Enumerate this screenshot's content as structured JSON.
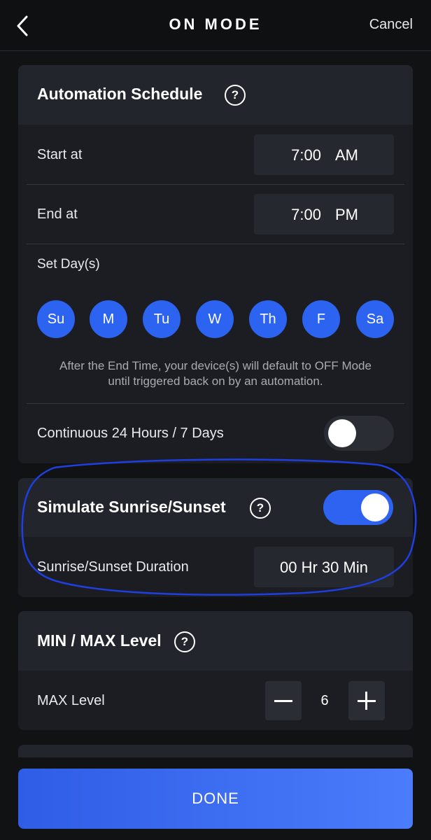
{
  "header": {
    "title": "ON MODE",
    "cancel_label": "Cancel"
  },
  "schedule": {
    "title": "Automation Schedule",
    "start_label": "Start at",
    "start_time": "7:00",
    "start_ampm": "AM",
    "end_label": "End at",
    "end_time": "7:00",
    "end_ampm": "PM",
    "days_label": "Set Day(s)",
    "days": [
      "Su",
      "M",
      "Tu",
      "W",
      "Th",
      "F",
      "Sa"
    ],
    "note_line1": "After the End Time, your device(s) will default to OFF Mode",
    "note_line2": "until triggered back on by an automation.",
    "continuous_label": "Continuous 24 Hours / 7 Days",
    "continuous_on": false
  },
  "sunrise": {
    "title": "Simulate Sunrise/Sunset",
    "enabled": true,
    "duration_label": "Sunrise/Sunset Duration",
    "duration_value": "00 Hr 30 Min"
  },
  "level": {
    "title": "MIN / MAX Level",
    "max_label": "MAX Level",
    "max_value": "6"
  },
  "done_label": "DONE",
  "colors": {
    "accent": "#2c63f0",
    "background": "#111214",
    "card": "#1b1d22",
    "annotation": "#1f3fe0"
  },
  "icons": [
    "back-arrow-icon",
    "help-icon",
    "minus-icon",
    "plus-icon"
  ]
}
